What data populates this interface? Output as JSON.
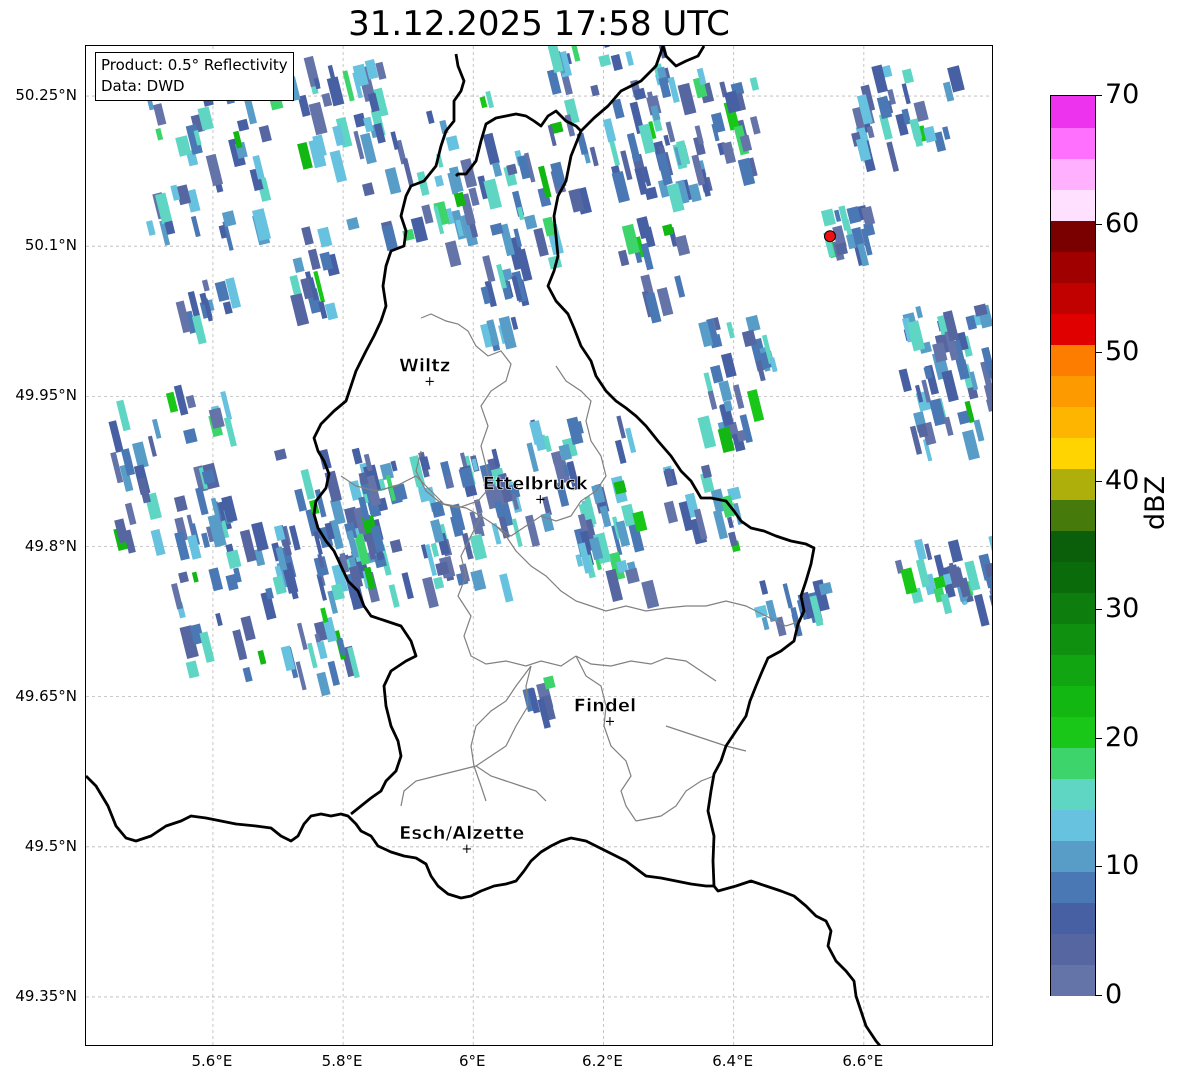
{
  "title": "31.12.2025 17:58 UTC",
  "info": {
    "product": "Product: 0.5° Reflectivity",
    "source": "Data: DWD"
  },
  "axes": {
    "lat_ticks": [
      {
        "value": 50.25,
        "label": "50.25°N"
      },
      {
        "value": 50.1,
        "label": "50.1°N"
      },
      {
        "value": 49.95,
        "label": "49.95°N"
      },
      {
        "value": 49.8,
        "label": "49.8°N"
      },
      {
        "value": 49.65,
        "label": "49.65°N"
      },
      {
        "value": 49.5,
        "label": "49.5°N"
      },
      {
        "value": 49.35,
        "label": "49.35°N"
      }
    ],
    "lon_ticks": [
      {
        "value": 5.6,
        "label": "5.6°E"
      },
      {
        "value": 5.8,
        "label": "5.8°E"
      },
      {
        "value": 6.0,
        "label": "6°E"
      },
      {
        "value": 6.2,
        "label": "6.2°E"
      },
      {
        "value": 6.4,
        "label": "6.4°E"
      },
      {
        "value": 6.6,
        "label": "6.6°E"
      }
    ],
    "lon_range": [
      5.405,
      6.8
    ],
    "lat_range": [
      49.3,
      50.3
    ]
  },
  "cities": [
    {
      "name": "Wiltz",
      "lon": 5.933,
      "lat": 49.966
    },
    {
      "name": "Ettelbruck",
      "lon": 6.103,
      "lat": 49.848
    },
    {
      "name": "Findel",
      "lon": 6.21,
      "lat": 49.626
    },
    {
      "name": "Esch/Alzette",
      "lon": 5.99,
      "lat": 49.499
    }
  ],
  "radar_site": {
    "lon": 6.548,
    "lat": 50.11,
    "color": "#ee1111"
  },
  "colorbar": {
    "unit": "dBZ",
    "min": 0,
    "max": 70,
    "tick_labels": [
      "0",
      "10",
      "20",
      "30",
      "40",
      "50",
      "60",
      "70"
    ],
    "colors": [
      "#6473a8",
      "#5666a0",
      "#4660a3",
      "#4a78b4",
      "#589cc8",
      "#66c2de",
      "#5fd6c3",
      "#3ed46c",
      "#18c718",
      "#12b712",
      "#11a511",
      "#0f910f",
      "#0d7e0d",
      "#0a6b0a",
      "#0b5f0b",
      "#467a0a",
      "#aeaf0a",
      "#ffd400",
      "#fdb500",
      "#fd9a00",
      "#fd7d00",
      "#e00000",
      "#c10000",
      "#a00000",
      "#7a0000",
      "#ffe1ff",
      "#ffb1ff",
      "#ff70ff",
      "#ee33ee"
    ]
  }
}
